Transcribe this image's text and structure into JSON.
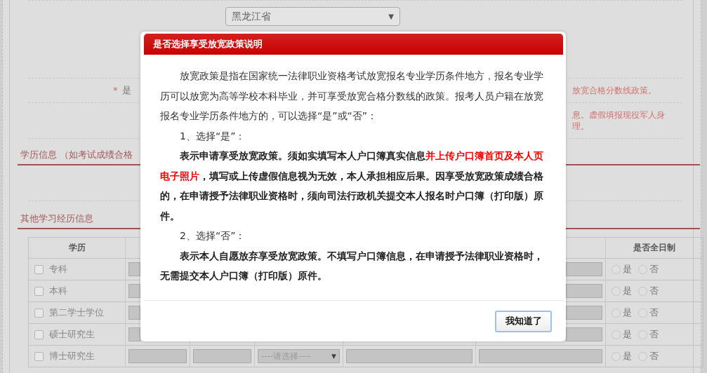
{
  "background": {
    "province_select": {
      "value": "黑龙江省",
      "arrow": "▼"
    },
    "question_row": {
      "required_mark": "*",
      "label": "是",
      "note": "放宽合格分数线政策。"
    },
    "notice": [
      "息。虚假填报现役军人身",
      "理。"
    ],
    "education_section": {
      "title": "学历信息 （如考试成绩合格"
    },
    "other_section": {
      "title": "其他学习经历信息"
    },
    "table": {
      "first_column_header": "学历",
      "last_column_header": "是否全日制",
      "rows": [
        {
          "degree": "专科",
          "checked": false,
          "options": [
            {
              "label": "是",
              "selected": false
            },
            {
              "label": "否",
              "selected": false
            }
          ]
        },
        {
          "degree": "本科",
          "checked": false,
          "options": [
            {
              "label": "是",
              "selected": false
            },
            {
              "label": "否",
              "selected": false
            }
          ]
        },
        {
          "degree": "第二学士学位",
          "checked": false,
          "options": [
            {
              "label": "是",
              "selected": false
            },
            {
              "label": "否",
              "selected": false
            }
          ]
        },
        {
          "degree": "硕士研究生",
          "checked": false,
          "options": [
            {
              "label": "是",
              "selected": false
            },
            {
              "label": "否",
              "selected": false
            }
          ]
        },
        {
          "degree": "博士研究生",
          "checked": false,
          "select_placeholder": "----请选择----",
          "select_arrow": "▼",
          "options": [
            {
              "label": "是",
              "selected": false
            },
            {
              "label": "否",
              "selected": false
            }
          ]
        }
      ]
    }
  },
  "dialog": {
    "title": "是否选择享受放宽政策说明",
    "paragraphs": [
      {
        "kind": "normal",
        "segments": [
          {
            "text": "放宽政策是指在国家统一法律职业资格考试放宽报名专业学历条件地方，报名专业学历可以放宽为高等学校本科毕业，并可享受放宽合格分数线的政策。报考人员户籍在放宽报名专业学历条件地方的，可以选择“是”或“否”：",
            "emphasis": false
          }
        ]
      },
      {
        "kind": "normal",
        "segments": [
          {
            "text": "1、选择“是”：",
            "emphasis": false
          }
        ]
      },
      {
        "kind": "bold",
        "segments": [
          {
            "text": "表示申请享受放宽政策。须如实填写本人户口簿真实信息",
            "emphasis": false
          },
          {
            "text": "并上传户口簿首页及本人页电子照片",
            "emphasis": true
          },
          {
            "text": "，填写或上传虚假信息视为无效，本人承担相应后果。因享受放宽政策成绩合格的，在申请授予法律职业资格时，须向司法行政机关提交本人报名时户口簿（打印版）原件。",
            "emphasis": false
          }
        ]
      },
      {
        "kind": "normal",
        "segments": [
          {
            "text": "2、选择“否”：",
            "emphasis": false
          }
        ]
      },
      {
        "kind": "bold",
        "segments": [
          {
            "text": "表示本人自愿放弃享受放宽政策。不填写户口簿信息，在申请授予法律职业资格时，无需提交本人户口簿（打印版）原件。",
            "emphasis": false
          }
        ]
      }
    ],
    "button": "我知道了"
  }
}
